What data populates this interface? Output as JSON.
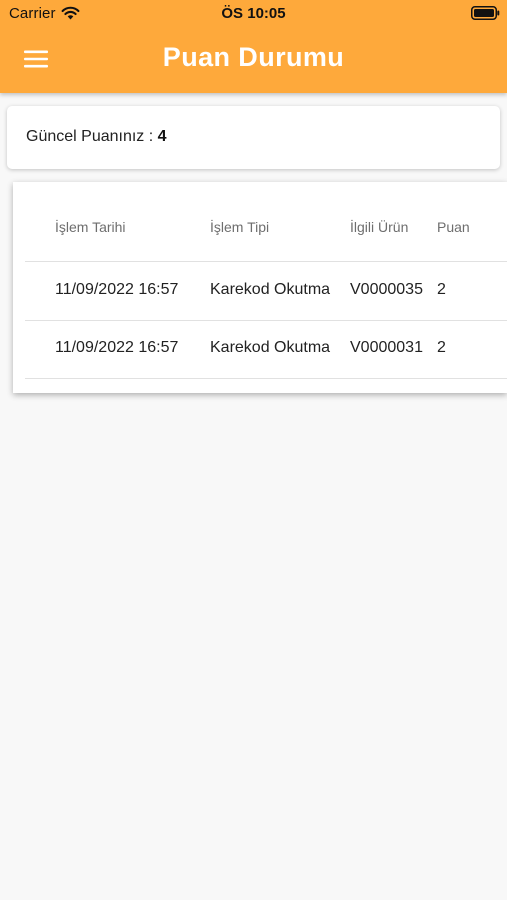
{
  "status_bar": {
    "carrier": "Carrier",
    "time": "ÖS 10:05"
  },
  "appbar": {
    "title": "Puan Durumu",
    "color": "#fea93b",
    "menu_icon": "hamburger-menu-icon"
  },
  "points": {
    "label": "Güncel Puanınız : ",
    "value": "4"
  },
  "table": {
    "headers": [
      "İşlem Tarihi",
      "İşlem Tipi",
      "İlgili Ürün",
      "Puan"
    ],
    "rows": [
      [
        "11/09/2022 16:57",
        "Karekod Okutma",
        "V0000035",
        "2"
      ],
      [
        "11/09/2022 16:57",
        "Karekod Okutma",
        "V0000031",
        "2"
      ]
    ]
  }
}
